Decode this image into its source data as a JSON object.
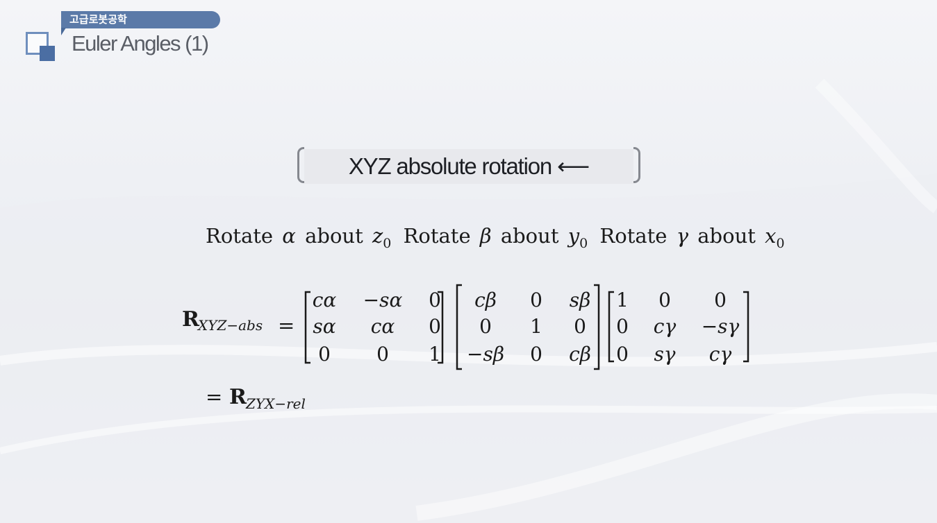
{
  "header": {
    "course_name": "고급로봇공학",
    "page_title": "Euler Angles (1)"
  },
  "heading": {
    "text": "XYZ absolute rotation ⟵"
  },
  "rotation_sentence": {
    "verb": "Rotate",
    "preposition": "about",
    "steps": [
      {
        "angle": "α",
        "axis": "z",
        "axis_sub": "0"
      },
      {
        "angle": "β",
        "axis": "y",
        "axis_sub": "0"
      },
      {
        "angle": "γ",
        "axis": "x",
        "axis_sub": "0"
      }
    ]
  },
  "equation": {
    "lhs_symbol": "R",
    "lhs_subscript": "XYZ−abs",
    "equals": "=",
    "matrices": [
      [
        [
          "cα",
          "−sα",
          "0"
        ],
        [
          "sα",
          "cα",
          "0"
        ],
        [
          "0",
          "0",
          "1"
        ]
      ],
      [
        [
          "cβ",
          "0",
          "sβ"
        ],
        [
          "0",
          "1",
          "0"
        ],
        [
          "−sβ",
          "0",
          "cβ"
        ]
      ],
      [
        [
          "1",
          "0",
          "0"
        ],
        [
          "0",
          "cγ",
          "−sγ"
        ],
        [
          "0",
          "sγ",
          "cγ"
        ]
      ]
    ],
    "result_symbol": "R",
    "result_subscript": "ZYX−rel"
  },
  "colors": {
    "accent": "#5b7aa8",
    "accent_dark": "#4b6ea3",
    "title_text": "#5a5e66",
    "heading_box": "#e8e9ed",
    "bracket": "#85888f"
  }
}
